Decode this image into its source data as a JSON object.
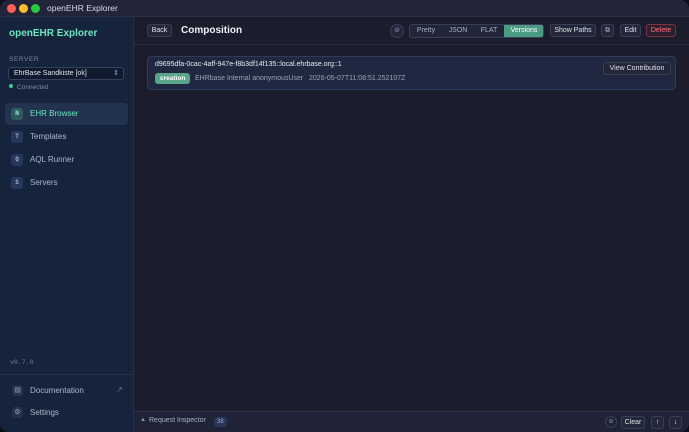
{
  "window": {
    "title": "openEHR Explorer"
  },
  "sidebar": {
    "app_name": "openEHR Explorer",
    "server_section_label": "SERVER",
    "server_select": "EhrBase Sandkiste [ok]",
    "connection_status": "Connected",
    "nav": [
      {
        "key": "N",
        "label": "EHR Browser",
        "active": true
      },
      {
        "key": "T",
        "label": "Templates",
        "active": false
      },
      {
        "key": "Q",
        "label": "AQL Runner",
        "active": false
      },
      {
        "key": "S",
        "label": "Servers",
        "active": false
      }
    ],
    "version": "v0.7.0",
    "footer": [
      {
        "icon": "book-icon",
        "label": "Documentation",
        "external": true
      },
      {
        "icon": "gear-icon",
        "label": "Settings",
        "external": false
      }
    ]
  },
  "toolbar": {
    "back_label": "Back",
    "title": "Composition",
    "view_modes": [
      "Pretty",
      "JSON",
      "FLAT",
      "Versions"
    ],
    "active_view": "Versions",
    "show_paths_label": "Show Paths",
    "edit_label": "Edit",
    "delete_label": "Delete"
  },
  "version_entry": {
    "id": "d9695dfa-0cac-4aff-947e-f8b3df14f135::local.ehrbase.org::1",
    "change_type": "creation",
    "committer": "EHRbase Internal anonymousUser",
    "timestamp": "2026-05-07T11:08:51.252107Z",
    "action_label": "View Contribution"
  },
  "request_inspector": {
    "label": "Request Inspector",
    "count": "38",
    "clear_label": "Clear"
  },
  "colors": {
    "accent": "#6ee7c0",
    "active_segment": "#4b9a83",
    "delete": "#ff7082",
    "sidebar_bg": "#16233d",
    "main_bg": "#1b1d2d"
  }
}
